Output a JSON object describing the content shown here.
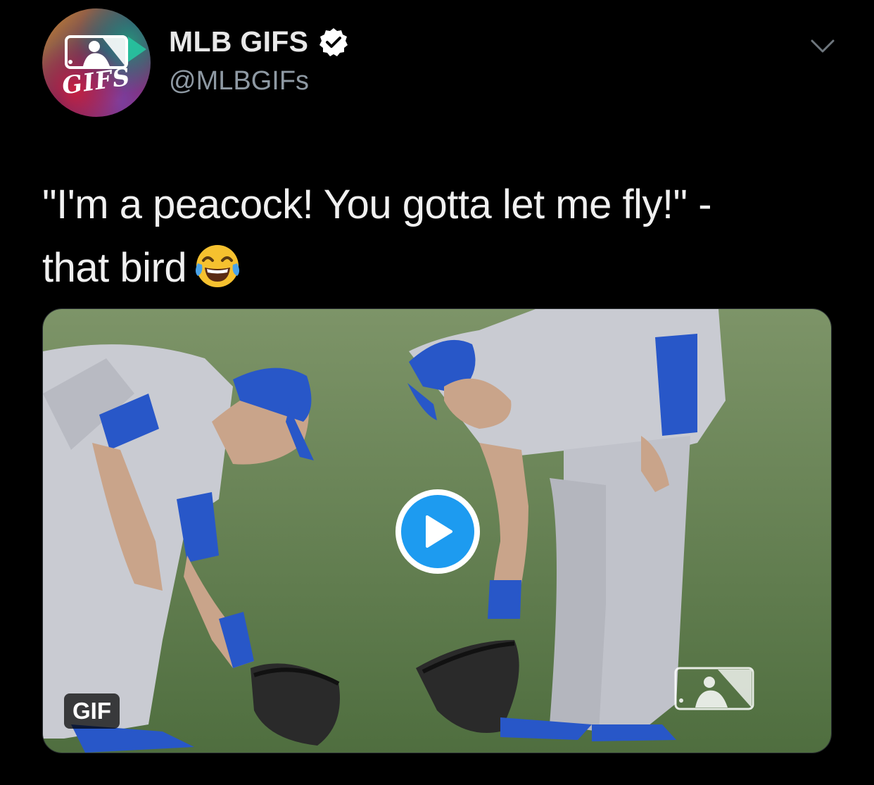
{
  "header": {
    "display_name": "MLB GIFS",
    "handle": "@MLBGIFs",
    "avatar_text": "GIFS",
    "verified": true
  },
  "tweet": {
    "line1": "\"I'm a peacock! You gotta let me fly!\" -",
    "line2": "that bird",
    "emoji": "face-with-tears-of-joy"
  },
  "media": {
    "badge": "GIF",
    "play_label": "play"
  },
  "colors": {
    "background": "#000000",
    "name": "#e8e8e8",
    "handle": "#8e99a3",
    "play_accent": "#1d9bf0",
    "field_green": "#5f7f4c",
    "dodger_blue": "#1f4fbf"
  }
}
